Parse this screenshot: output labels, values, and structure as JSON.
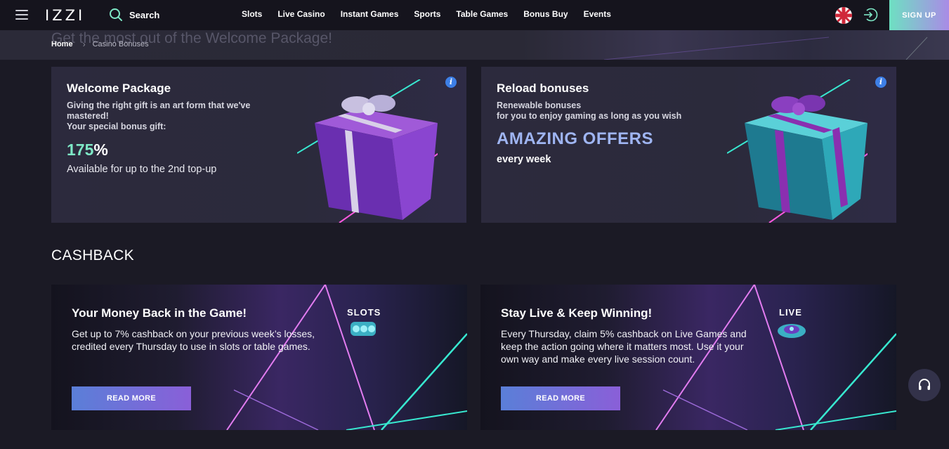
{
  "header": {
    "logo": "IZZI",
    "search_label": "Search",
    "nav": [
      "Slots",
      "Live Casino",
      "Instant Games",
      "Sports",
      "Table Games",
      "Bonus Buy",
      "Events"
    ],
    "signup_label": "SIGN UP"
  },
  "banner": {
    "title": "Get the most out of the Welcome Package!",
    "breadcrumb": {
      "home": "Home",
      "current": "Casino Bonuses"
    }
  },
  "welcome": {
    "title": "Welcome Package",
    "subtitle_line1": "Giving the right gift is an art form that we've mastered!",
    "subtitle_line2": "Your special bonus gift:",
    "percent_number": "175",
    "percent_sign": "%",
    "footer": "Available for up to the 2nd top-up"
  },
  "reload": {
    "title": "Reload bonuses",
    "subtitle_line1": "Renewable bonuses",
    "subtitle_line2": "for you to enjoy gaming as long as you wish",
    "highlight": "AMAZING OFFERS",
    "frequency": "every week"
  },
  "cashback": {
    "section_title": "CASHBACK",
    "cards": [
      {
        "title": "Your Money Back in the Game!",
        "text": "Get up to 7% cashback on your previous week’s losses, credited every Thursday to use in slots or table games.",
        "badge": "SLOTS",
        "button": "READ MORE"
      },
      {
        "title": "Stay Live & Keep Winning!",
        "text": "Every Thursday, claim 5% cashback on Live Games and keep the action going where it matters most. Use it your own way and make every live session count.",
        "badge": "LIVE",
        "button": "READ MORE"
      }
    ]
  },
  "colors": {
    "accent_teal": "#7ee8c6",
    "accent_blue": "#9fb5f2",
    "button_gradient_start": "#5a7fd8",
    "button_gradient_end": "#8a5fd8"
  }
}
